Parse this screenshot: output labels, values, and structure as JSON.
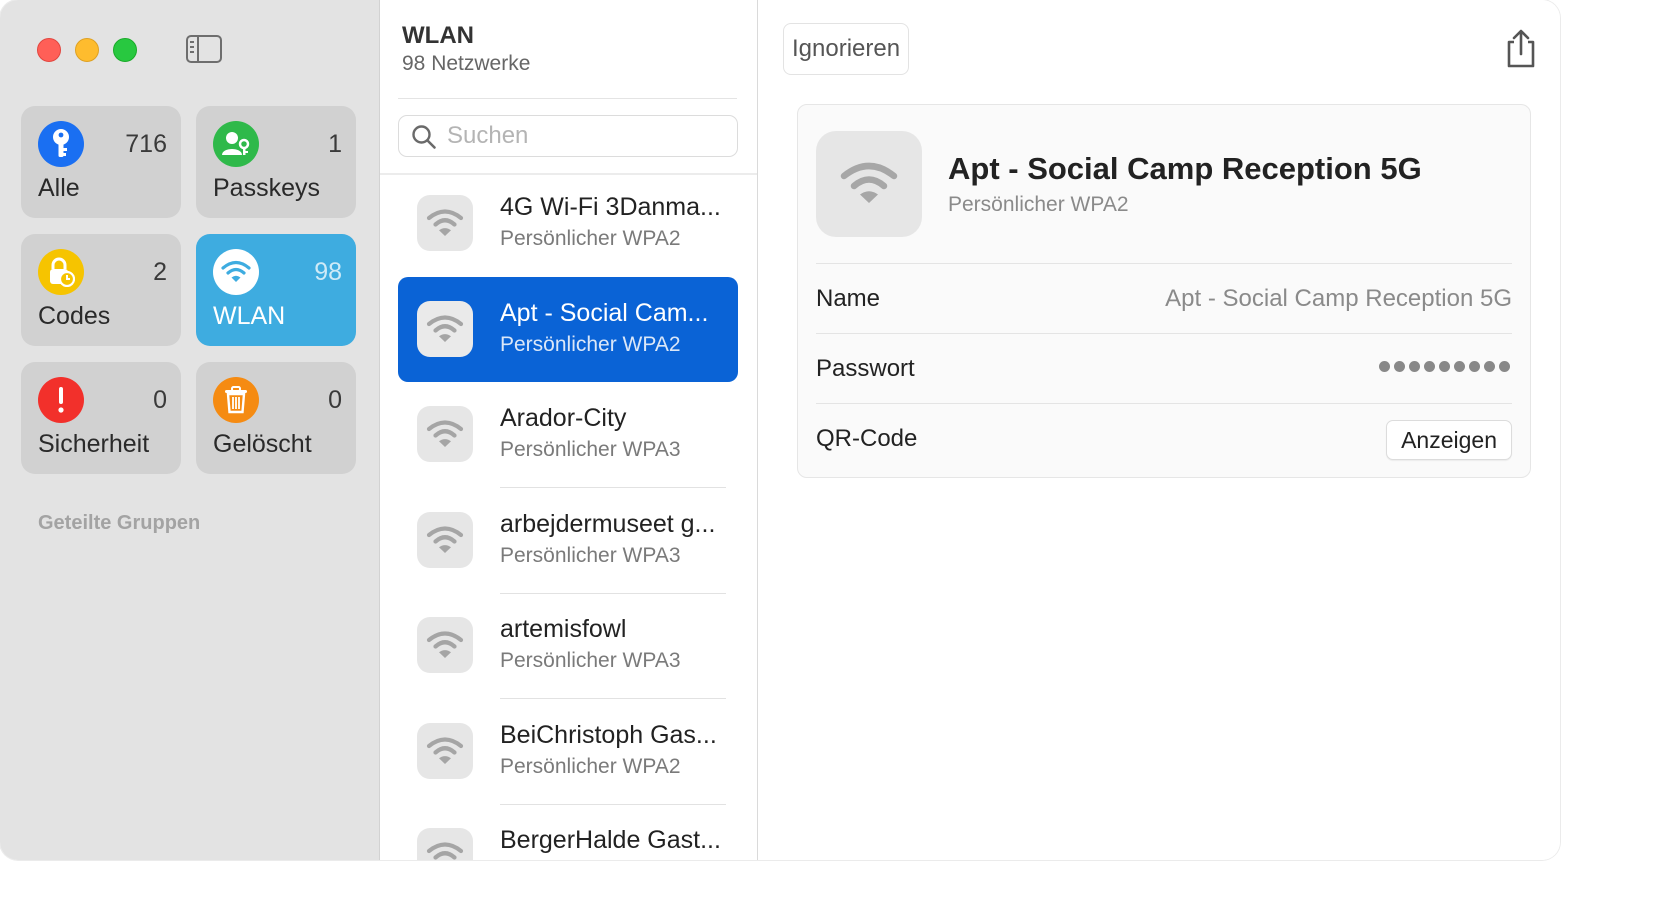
{
  "sidebar": {
    "toggle_icon": "sidebar-toggle-icon",
    "tiles": [
      {
        "id": "alle",
        "label": "Alle",
        "count": "716",
        "icon": "key-icon",
        "color": "#1a6ff2"
      },
      {
        "id": "passkeys",
        "label": "Passkeys",
        "count": "1",
        "icon": "person-key-icon",
        "color": "#2fb94a"
      },
      {
        "id": "codes",
        "label": "Codes",
        "count": "2",
        "icon": "lock-clock-icon",
        "color": "#f6c400"
      },
      {
        "id": "wlan",
        "label": "WLAN",
        "count": "98",
        "icon": "wifi-icon",
        "color": "#3eace0",
        "active": true
      },
      {
        "id": "sicherheit",
        "label": "Sicherheit",
        "count": "0",
        "icon": "exclamation-icon",
        "color": "#f2302b"
      },
      {
        "id": "geloescht",
        "label": "Gelöscht",
        "count": "0",
        "icon": "trash-icon",
        "color": "#f58b12"
      }
    ],
    "shared_groups_heading": "Geteilte Gruppen"
  },
  "list": {
    "title": "WLAN",
    "subtitle": "98 Netzwerke",
    "search_placeholder": "Suchen",
    "items": [
      {
        "name": "4G Wi-Fi 3Danma...",
        "type": "Persönlicher WPA2"
      },
      {
        "name": "Apt - Social Cam...",
        "type": "Persönlicher WPA2",
        "selected": true
      },
      {
        "name": "Arador-City",
        "type": "Persönlicher WPA3"
      },
      {
        "name": "arbejdermuseet g...",
        "type": "Persönlicher WPA3"
      },
      {
        "name": "artemisfowl",
        "type": "Persönlicher WPA3"
      },
      {
        "name": "BeiChristoph Gas...",
        "type": "Persönlicher WPA2"
      },
      {
        "name": "BergerHalde Gast...",
        "type": ""
      }
    ]
  },
  "detail": {
    "ignore_label": "Ignorieren",
    "title": "Apt - Social Camp Reception 5G",
    "subtitle": "Persönlicher WPA2",
    "fields": {
      "name_label": "Name",
      "name_value": "Apt - Social Camp Reception 5G",
      "password_label": "Passwort",
      "password_mask_length": 9,
      "qr_label": "QR-Code",
      "qr_button": "Anzeigen"
    }
  }
}
